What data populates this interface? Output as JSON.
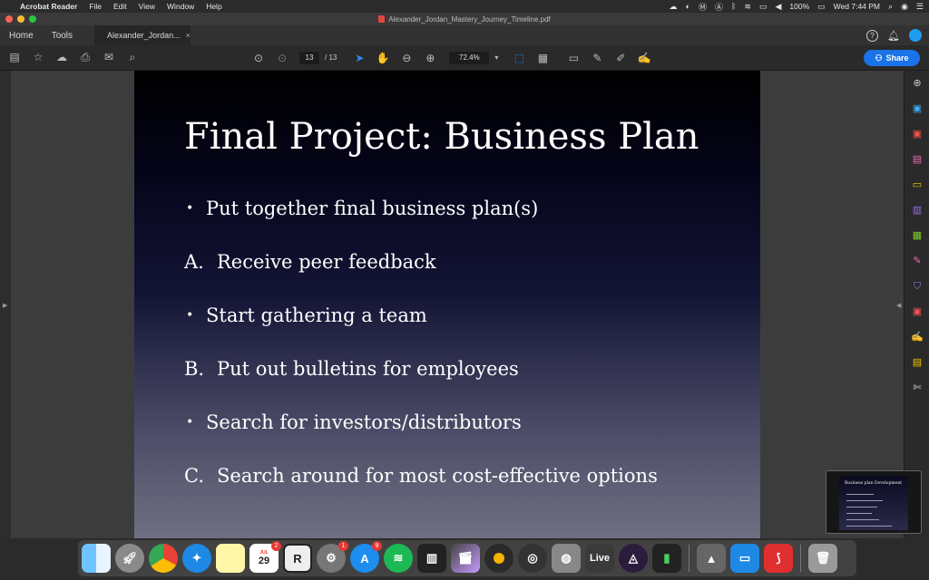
{
  "menubar": {
    "app_name": "Acrobat Reader",
    "menus": [
      "File",
      "Edit",
      "View",
      "Window",
      "Help"
    ],
    "battery": "100%",
    "clock": "Wed 7:44 PM"
  },
  "window": {
    "title": "Alexander_Jordan_Mastery_Journey_Timeline.pdf"
  },
  "tabs": {
    "home": "Home",
    "tools": "Tools",
    "document": "Alexander_Jordan...",
    "close_glyph": "×"
  },
  "toolbar": {
    "page_current": "13",
    "page_total": "/ 13",
    "zoom": "72.4%",
    "share_label": "Share"
  },
  "slide": {
    "title": "Final Project: Business Plan",
    "items": [
      {
        "marker": "•",
        "text": "Put together final business plan(s)"
      },
      {
        "marker": "A.",
        "text": "Receive peer feedback"
      },
      {
        "marker": "•",
        "text": "Start gathering a team"
      },
      {
        "marker": "B.",
        "text": "Put out bulletins for employees"
      },
      {
        "marker": "•",
        "text": "Search for investors/distributors"
      },
      {
        "marker": "C.",
        "text": "Search around for most cost-effective options"
      }
    ]
  },
  "thumbnail": {
    "title": "Business plan Development"
  },
  "dock": {
    "calendar_month": "JUL",
    "calendar_day": "29",
    "calendar_badge": "2",
    "prefs_badge": "1",
    "appstore_badge": "9",
    "live_label": "Live"
  },
  "colors": {
    "accent": "#1a73e8",
    "slide_text": "#ffffff"
  }
}
